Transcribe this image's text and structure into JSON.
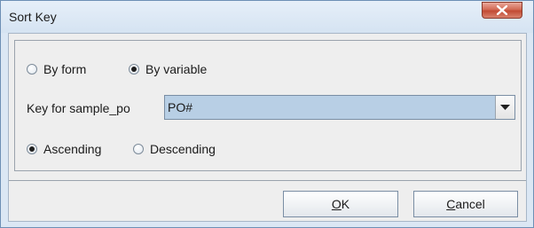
{
  "window": {
    "title": "Sort Key",
    "close_icon": "close-icon"
  },
  "mode": {
    "by_form_label": "By form",
    "by_variable_label": "By variable",
    "selected": "By variable"
  },
  "key": {
    "label": "Key for sample_po",
    "value": "PO#"
  },
  "order": {
    "ascending_label": "Ascending",
    "descending_label": "Descending",
    "selected": "Ascending"
  },
  "buttons": {
    "ok_mnemonic": "O",
    "ok_rest": "K",
    "cancel_mnemonic": "C",
    "cancel_rest": "ancel"
  }
}
